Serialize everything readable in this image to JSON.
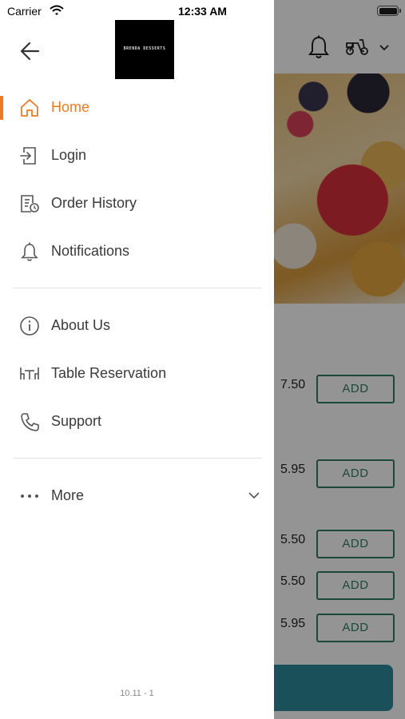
{
  "status_bar": {
    "carrier": "Carrier",
    "time": "12:33 AM"
  },
  "drawer": {
    "logo_text": "BRENDA DESSERTS",
    "menu_primary": [
      {
        "label": "Home",
        "icon": "home-icon",
        "active": true
      },
      {
        "label": "Login",
        "icon": "login-icon",
        "active": false
      },
      {
        "label": "Order History",
        "icon": "order-history-icon",
        "active": false
      },
      {
        "label": "Notifications",
        "icon": "bell-icon",
        "active": false
      }
    ],
    "menu_secondary": [
      {
        "label": "About Us",
        "icon": "info-icon"
      },
      {
        "label": "Table Reservation",
        "icon": "table-icon"
      },
      {
        "label": "Support",
        "icon": "phone-icon"
      }
    ],
    "more": {
      "label": "More",
      "icon": "more-dots-icon"
    },
    "version": "10.11 - 1"
  },
  "background": {
    "items": [
      {
        "price": "7.50",
        "add_label": "ADD"
      },
      {
        "price": "5.95",
        "add_label": "ADD"
      },
      {
        "price": "5.50",
        "add_label": "ADD"
      },
      {
        "price": "5.50",
        "add_label": "ADD"
      },
      {
        "price": "5.95",
        "add_label": "ADD"
      }
    ]
  },
  "colors": {
    "accent": "#ee7a23",
    "add_button": "#2f7d63",
    "cart_bar": "#2e8a9c",
    "text": "#3a3a3a"
  }
}
